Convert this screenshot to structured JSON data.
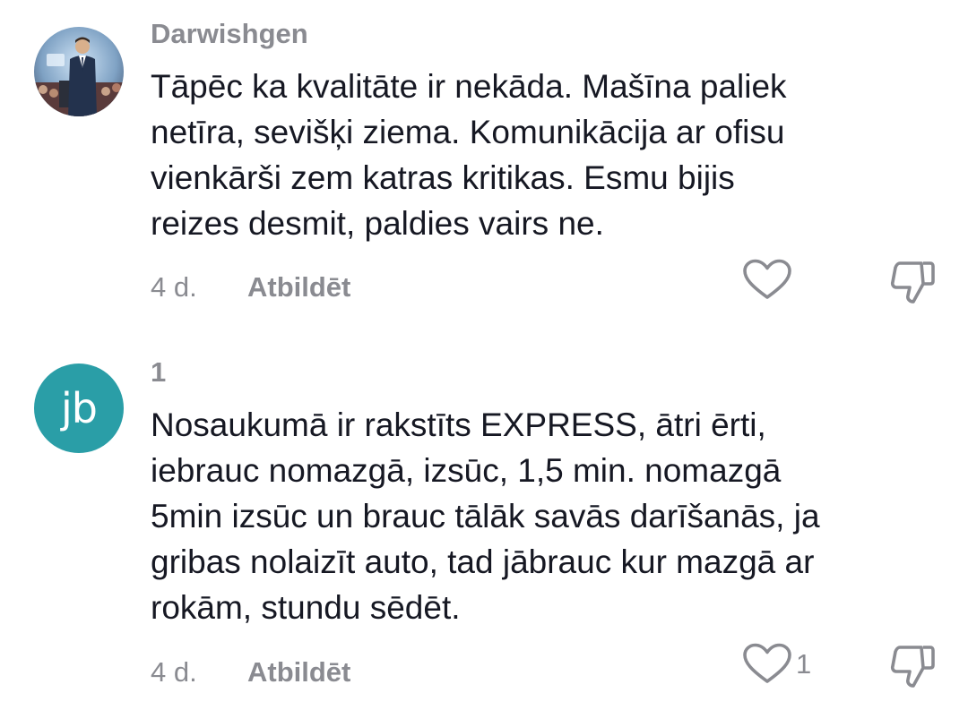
{
  "comments": [
    {
      "username": "Darwishgen",
      "avatar": {
        "type": "photo",
        "description": "man in suit at podium"
      },
      "text": "Tāpēc ka kvalitāte ir nekāda. Mašīna paliek\nnetīra, sevišķi ziema. Komunikācija ar ofisu\nvienkārši zem katras kritikas. Esmu bijis\nreizes desmit, paldies vairs ne.",
      "time": "4 d.",
      "reply_label": "Atbildēt",
      "like_count": "",
      "icons": {
        "like": "heart-icon",
        "dislike": "thumbs-down-icon"
      }
    },
    {
      "username": "1",
      "avatar": {
        "type": "initials",
        "initials": "jb",
        "color": "#2a9ea7"
      },
      "text": "Nosaukumā ir rakstīts EXPRESS, ātri ērti,\niebrauc nomazgā, izsūc, 1,5 min. nomazgā\n5min izsūc un brauc tālāk savās darīšanās, ja\ngribas nolaizīt auto, tad jābrauc kur mazgā ar\nrokām, stundu sēdēt.",
      "time": "4 d.",
      "reply_label": "Atbildēt",
      "like_count": "1",
      "icons": {
        "like": "heart-icon",
        "dislike": "thumbs-down-icon"
      }
    }
  ],
  "colors": {
    "text": "#161823",
    "muted": "#8a8b91",
    "avatar_bg": "#2a9ea7"
  }
}
